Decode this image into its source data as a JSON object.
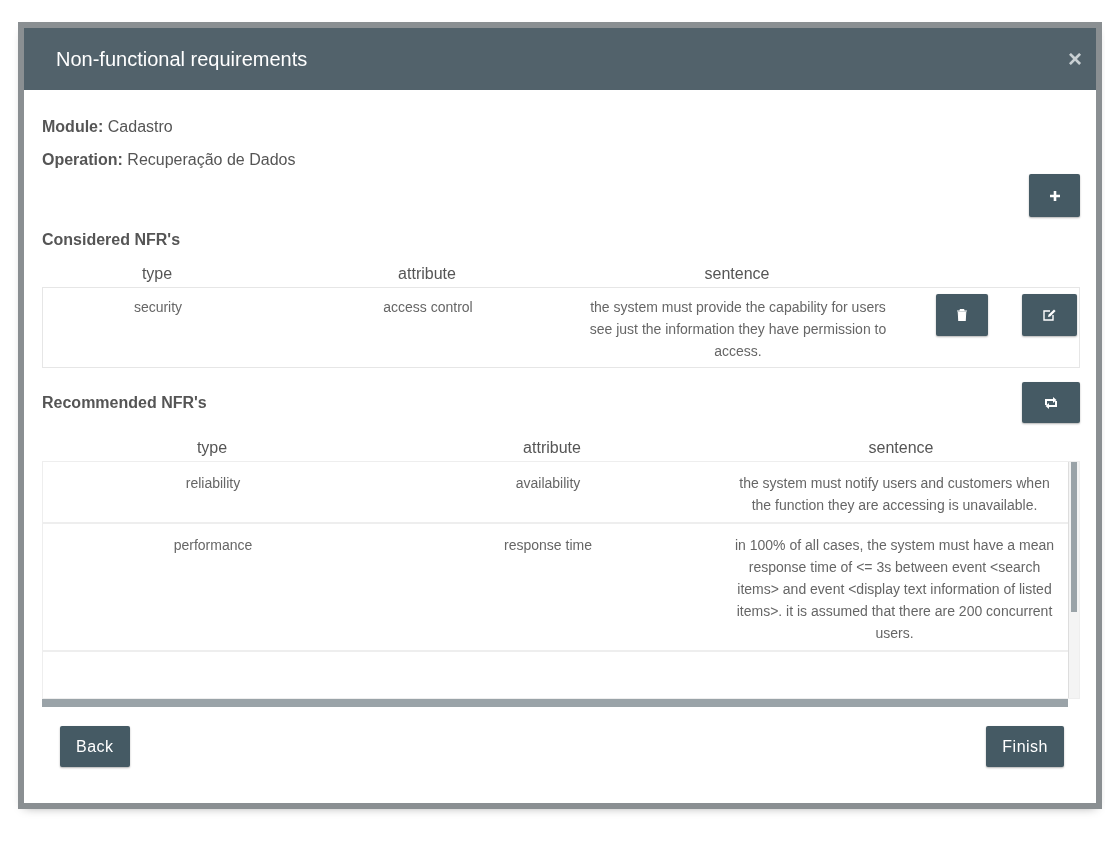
{
  "dialog": {
    "title": "Non-functional requirements",
    "close": "×"
  },
  "info": [
    {
      "label": "Module:",
      "value": "Cadastro"
    },
    {
      "label": "Operation:",
      "value": "Recuperação de Dados"
    }
  ],
  "considered": {
    "heading": "Considered NFR's",
    "columns": [
      "type",
      "attribute",
      "sentence"
    ],
    "rows": [
      {
        "type": "security",
        "attribute": "access control",
        "sentence": "the system must provide the capability for users see just the information they have permission to access."
      }
    ]
  },
  "recommended": {
    "heading": "Recommended NFR's",
    "columns": [
      "type",
      "attribute",
      "sentence"
    ],
    "rows": [
      {
        "type": "reliability",
        "attribute": "availability",
        "sentence": "the system must notify users and customers when the function they are accessing is unavailable."
      },
      {
        "type": "performance",
        "attribute": "response time",
        "sentence": "in 100% of all cases, the system must have a mean response time of <= 3s between event <search items> and event <display text information of listed items>. it is assumed that there are 200 concurrent users."
      }
    ]
  },
  "footer": {
    "back": "Back",
    "finish": "Finish"
  }
}
